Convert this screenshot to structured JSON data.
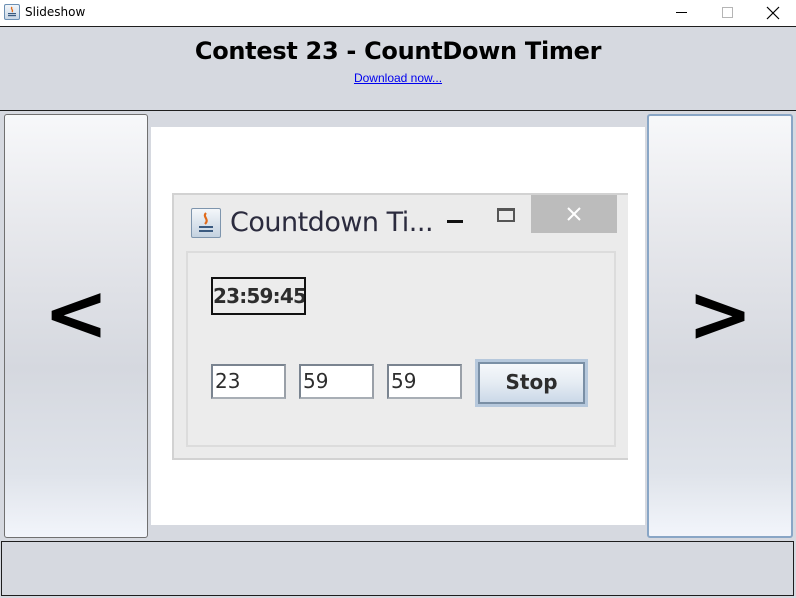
{
  "window": {
    "title": "Slideshow",
    "icon": "java-coffee-icon",
    "controls": [
      "minimize",
      "maximize",
      "close"
    ]
  },
  "header": {
    "title": "Contest 23 - CountDown Timer",
    "link_text": "Download now..."
  },
  "navigation": {
    "prev_label": "<",
    "next_label": ">"
  },
  "slide": {
    "window_title": "Countdown Ti...",
    "window_icon": "java-coffee-icon",
    "time_display": "23:59:45",
    "inputs": {
      "hours": "23",
      "minutes": "59",
      "seconds": "59"
    },
    "button_label": "Stop"
  },
  "colors": {
    "panel_bg": "#d6d9e0",
    "link": "#0000ee",
    "mini_close_bg": "#bcbcbc"
  }
}
